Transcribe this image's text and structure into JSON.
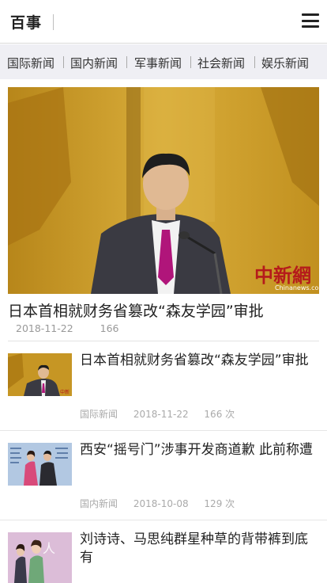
{
  "header": {
    "logo": "百事"
  },
  "nav": {
    "categories": [
      {
        "label": "国际新闻"
      },
      {
        "label": "国内新闻"
      },
      {
        "label": "军事新闻"
      },
      {
        "label": "社会新闻"
      },
      {
        "label": "娱乐新闻"
      }
    ]
  },
  "featured": {
    "title": "日本首相就财务省篡改“森友学园”审批",
    "date": "2018-11-22",
    "views": "166",
    "watermark_main": "中新網",
    "watermark_sub": "Chinanews.com"
  },
  "list": [
    {
      "title": "日本首相就财务省篡改“森友学园”审批",
      "category": "国际新闻",
      "date": "2018-11-22",
      "views": "166 次"
    },
    {
      "title": "西安“摇号门”涉事开发商道歉 此前称遭",
      "category": "国内新闻",
      "date": "2018-10-08",
      "views": "129 次"
    },
    {
      "title": "刘诗诗、马思纯群星种草的背带裤到底有",
      "category": "",
      "date": "",
      "views": ""
    }
  ],
  "colors": {
    "background": "#ffffff",
    "nav_bg": "#efeff4",
    "meta_text": "#999999",
    "title_text": "#222222"
  }
}
